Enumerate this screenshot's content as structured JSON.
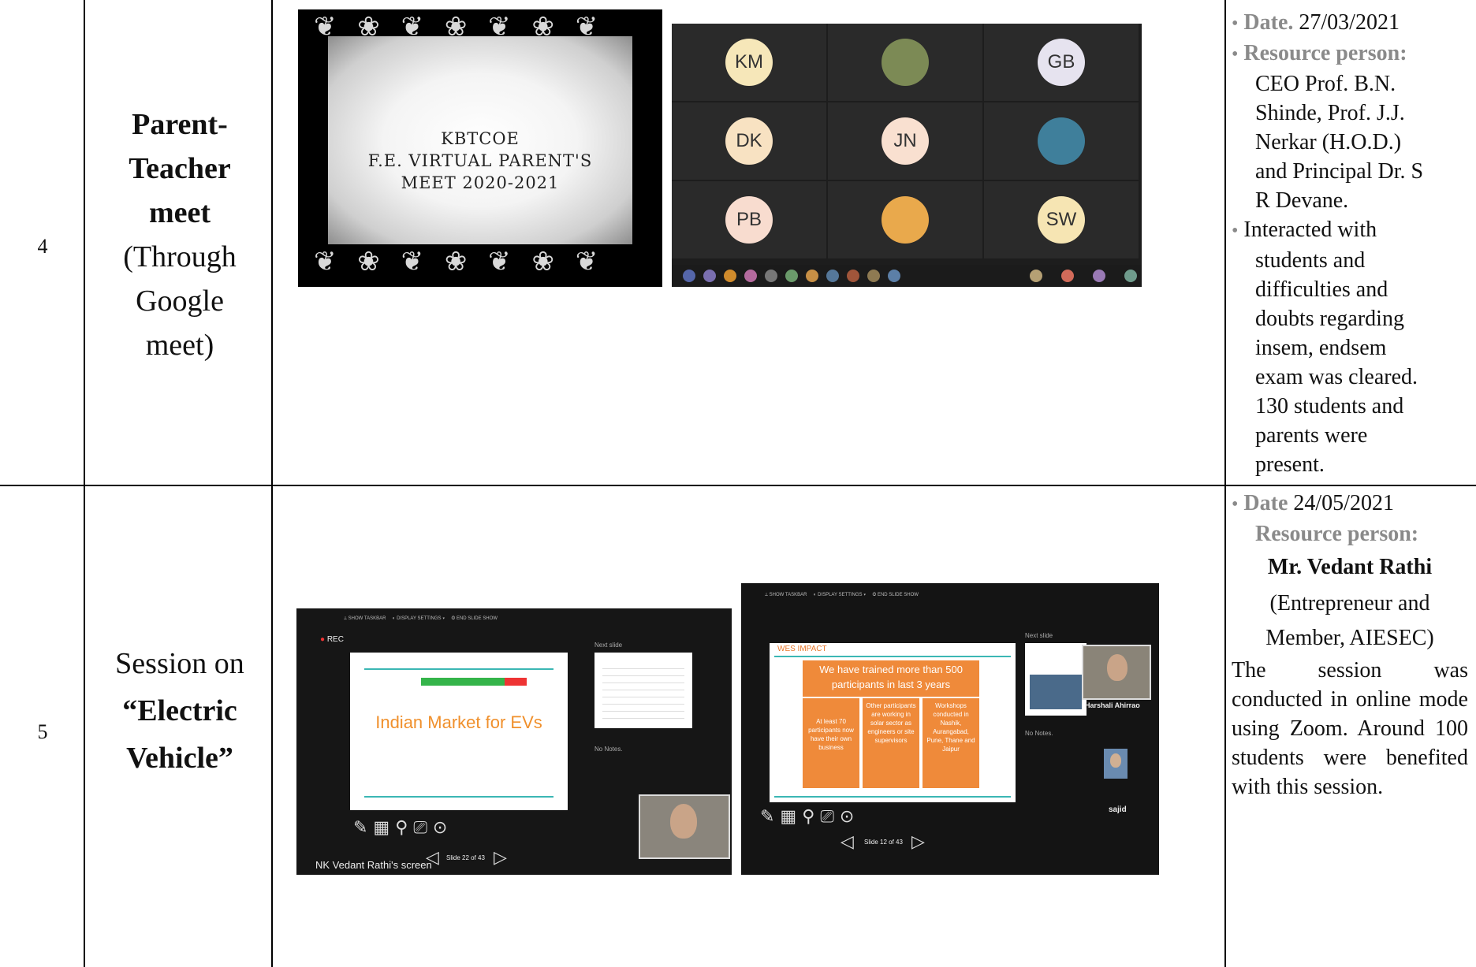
{
  "rows": [
    {
      "sno": "4",
      "title_bold_lines": [
        "Parent-",
        "Teacher",
        "meet"
      ],
      "title_normal_lines": [
        "(Through",
        "Google",
        "meet)"
      ],
      "slide": {
        "lines": [
          "KBTCOE",
          "F.E. VIRTUAL PARENT'S",
          "MEET 2020-2021"
        ]
      },
      "meet_tiles": [
        {
          "initials": "KM",
          "color": "#f6e7b9"
        },
        {
          "initials": "",
          "color": "#7c8a55"
        },
        {
          "initials": "GB",
          "color": "#e6e3ef"
        },
        {
          "initials": "DK",
          "color": "#f8e2c2"
        },
        {
          "initials": "JN",
          "color": "#f9e0d0"
        },
        {
          "initials": "",
          "color": "#3f7f9b"
        },
        {
          "initials": "PB",
          "color": "#f8dccf"
        },
        {
          "initials": "",
          "color": "#e9a94c"
        },
        {
          "initials": "SW",
          "color": "#f6e5b3"
        }
      ],
      "details": {
        "date_label": "Date.",
        "date_value": "27/03/2021",
        "resource_label": "Resource person:",
        "resource_lines": [
          "CEO Prof. B.N.",
          "Shinde, Prof. J.J.",
          "Nerkar (H.O.D.)",
          "and Principal Dr. S",
          "R Devane."
        ],
        "interaction_lines": [
          "Interacted with",
          "students and",
          "difficulties and",
          "doubts regarding",
          "insem, endsem",
          "exam was cleared.",
          "130 students and",
          "parents were",
          "present."
        ]
      }
    },
    {
      "sno": "5",
      "title_normal_line": "Session on",
      "title_bold_lines": [
        "“Electric",
        "Vehicle”"
      ],
      "share1": {
        "slide_title": "Indian Market for EVs",
        "slide_counter": "Slide 22 of 43",
        "presenter": "NK Vedant Rathi's screen",
        "rec": "REC",
        "next": "Next slide",
        "notes": "No Notes."
      },
      "share2": {
        "heading": "WES IMPACT",
        "banner_line1": "We have trained more than 500",
        "banner_line2": "participants in last 3 years",
        "box1": "At least 70 participants now have their own business",
        "box2": "Other participants are working in solar sector as engineers or site supervisors",
        "box3": "Workshops conducted in Nashik, Aurangabad, Pune, Thane and Jaipur",
        "slide_counter": "Slide 12 of 43",
        "next": "Next slide",
        "notes": "No Notes.",
        "participant1": "Harshali Ahirrao",
        "participant2": "sajid"
      },
      "details": {
        "date_label": "Date",
        "date_value": "24/05/2021",
        "resource_label": "Resource person:",
        "person_name": "Mr. Vedant Rathi",
        "person_role_lines": [
          "(Entrepreneur and",
          "Member, AIESEC)"
        ],
        "summary": "The session was conducted in online mode using Zoom. Around 100 students were benefited with this session."
      }
    }
  ]
}
